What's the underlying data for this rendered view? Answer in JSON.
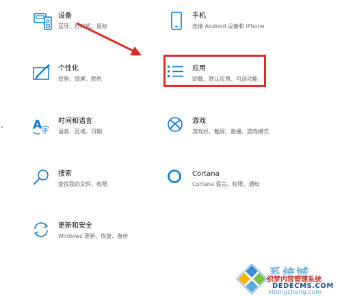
{
  "settings": {
    "tiles": [
      {
        "id": "devices",
        "title": "设备",
        "desc": "蓝牙、打印机、鼠标",
        "icon": "devices-icon"
      },
      {
        "id": "phone",
        "title": "手机",
        "desc": "连接 Android 设备和 iPhone",
        "icon": "phone-icon"
      },
      {
        "id": "personalization",
        "title": "个性化",
        "desc": "背景、锁屏、颜色",
        "icon": "personalization-icon"
      },
      {
        "id": "apps",
        "title": "应用",
        "desc": "卸载、默认应用、可选功能",
        "icon": "apps-icon"
      },
      {
        "id": "time-language",
        "title": "时间和语言",
        "desc": "语音、区域、日期",
        "icon": "time-language-icon"
      },
      {
        "id": "gaming",
        "title": "游戏",
        "desc": "游戏栏、截屏、直播、游戏模式",
        "icon": "xbox-icon"
      },
      {
        "id": "search",
        "title": "搜索",
        "desc": "查找我的文件、权限",
        "icon": "search-icon"
      },
      {
        "id": "cortana",
        "title": "Cortana",
        "desc": "Cortana 语言、权限、通知",
        "icon": "cortana-icon"
      },
      {
        "id": "update-security",
        "title": "更新和安全",
        "desc": "Windows 更新、恢复、备份",
        "icon": "update-icon"
      }
    ]
  },
  "colors": {
    "accent": "#0078d7",
    "highlight": "#e02a2a"
  },
  "watermark": {
    "logo_text": "系统城",
    "subtitle": "织梦内容管理系统",
    "domain": "DEDECMS.COM",
    "url": "xitongcheng.com"
  }
}
